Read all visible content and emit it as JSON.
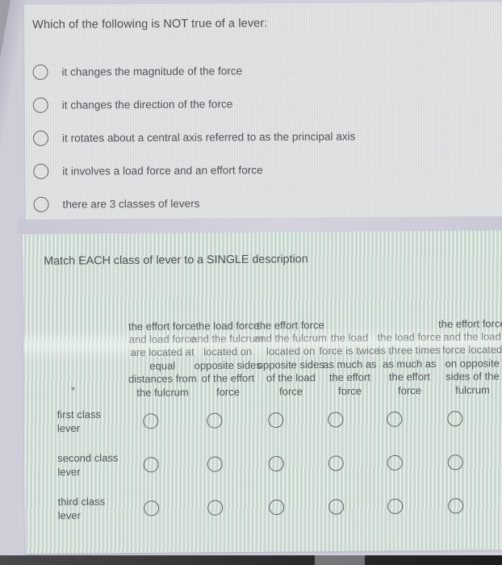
{
  "question1": {
    "title": "Which of the following is NOT true of a lever:",
    "options": [
      "it changes the magnitude of the force",
      "it changes the direction of the force",
      "it rotates about a central axis referred to as the principal axis",
      "it involves a load force and an effort force",
      "there are 3 classes of levers"
    ],
    "selected": null
  },
  "question2": {
    "title": "Match EACH class of lever to a SINGLE description",
    "columns": [
      "the effort force and load force are located at equal distances from the fulcrum",
      "the load force and the fulcrum located on opposite sides of the effort force",
      "the effort force and the fulcrum located on opposite sides of the load force",
      "the load force is twice as much as the effort force",
      "the load force is three times as much as the effort force",
      "the effort force and the load force located on opposite sides of the fulcrum"
    ],
    "rows": [
      "first class lever",
      "second class lever",
      "third class lever"
    ],
    "selections": [
      null,
      null,
      null
    ]
  },
  "colors": {
    "text": "#53575c",
    "radio_border": "#5f6468",
    "card_question_bg": "#e9eaea",
    "card_match_bg": "#ecefec",
    "page_bg": "#cfcdd8"
  }
}
